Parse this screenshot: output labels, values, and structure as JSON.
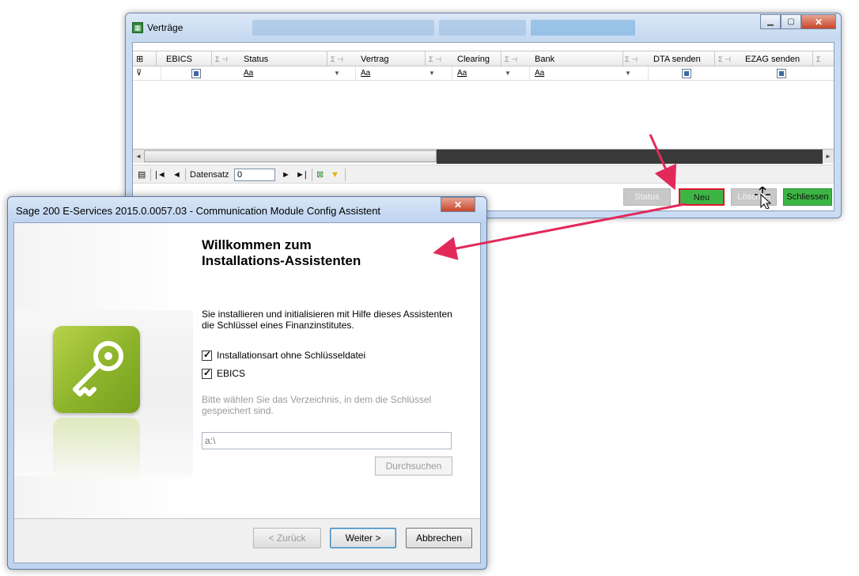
{
  "vertraege": {
    "title": "Verträge",
    "columns": [
      {
        "label": "EBICS"
      },
      {
        "label": "Status"
      },
      {
        "label": "Vertrag"
      },
      {
        "label": "Clearing"
      },
      {
        "label": "Bank"
      },
      {
        "label": "DTA senden"
      },
      {
        "label": "EZAG senden"
      }
    ],
    "sigma_pin": "Σ ⊣",
    "sigma": "Σ",
    "filter_text": "Aa",
    "nav": {
      "first": "|◄",
      "prev": "◄",
      "record_label": "Datensatz",
      "record_value": "0",
      "next": "►",
      "last": "►|"
    },
    "buttons": {
      "status": "Status",
      "neu": "Neu",
      "loeschen": "Löschen",
      "schliessen": "Schliessen"
    }
  },
  "assistant": {
    "title": "Sage 200 E-Services 2015.0.0057.03 - Communication Module Config Assistent",
    "heading_line1": "Willkommen zum",
    "heading_line2": "Installations-Assistenten",
    "intro": "Sie installieren und initialisieren mit Hilfe dieses Assistenten die Schlüssel eines Finanzinstitutes.",
    "checkbox1": "Installationsart ohne Schlüsseldatei",
    "checkbox2": "EBICS",
    "hint": "Bitte wählen Sie das Verzeichnis, in dem die Schlüssel gespeichert sind.",
    "path_value": "a:\\",
    "browse": "Durchsuchen",
    "back": "< Zurück",
    "next": "Weiter >",
    "cancel": "Abbrechen"
  },
  "colors": {
    "green_button": "#3db545",
    "red_highlight": "#e2182c",
    "arrow_pink": "#e22a5a",
    "key_tile": "#8cb32a"
  }
}
